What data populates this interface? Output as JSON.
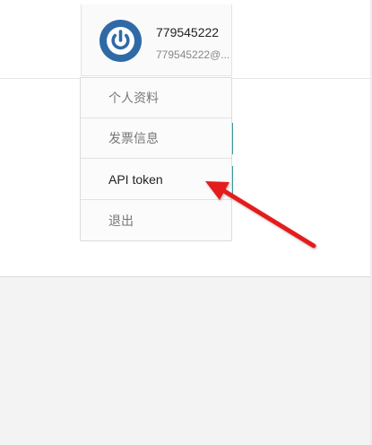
{
  "user": {
    "name": "779545222",
    "email": "779545222@...",
    "avatar_icon": "power-icon",
    "avatar_color": "#2f6aa6"
  },
  "menu": {
    "items": [
      {
        "label": "个人资料"
      },
      {
        "label": "发票信息"
      },
      {
        "label": "API token"
      },
      {
        "label": "退出"
      }
    ],
    "highlighted_index": 2
  },
  "annotation": {
    "type": "arrow",
    "color": "#e41b1b",
    "points_to": "API token"
  },
  "colors": {
    "accent": "#3a9a9c",
    "page_background": "#f3f3f3"
  }
}
